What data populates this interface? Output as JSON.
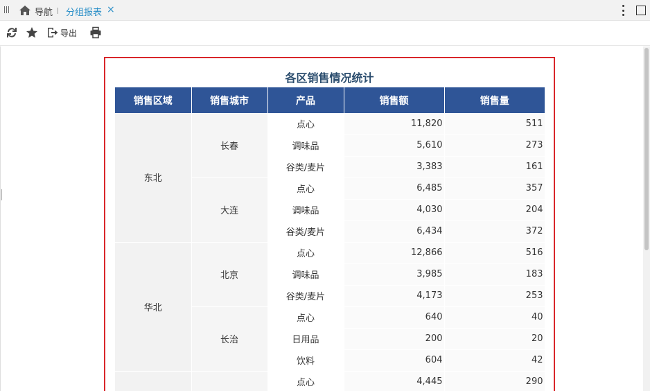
{
  "tabs": {
    "nav_label": "导航",
    "active_label": "分组报表",
    "close_glyph": "×"
  },
  "toolbar": {
    "export_label": "导出"
  },
  "report": {
    "title": "各区销售情况统计",
    "columns": [
      "销售区域",
      "销售城市",
      "产品",
      "销售额",
      "销售量"
    ],
    "groups": [
      {
        "region": "东北",
        "cities": [
          {
            "city": "长春",
            "rows": [
              {
                "product": "点心",
                "amount": "11,820",
                "qty": "511"
              },
              {
                "product": "调味品",
                "amount": "5,610",
                "qty": "273"
              },
              {
                "product": "谷类/麦片",
                "amount": "3,383",
                "qty": "161"
              }
            ]
          },
          {
            "city": "大连",
            "rows": [
              {
                "product": "点心",
                "amount": "6,485",
                "qty": "357"
              },
              {
                "product": "调味品",
                "amount": "4,030",
                "qty": "204"
              },
              {
                "product": "谷类/麦片",
                "amount": "6,434",
                "qty": "372"
              }
            ]
          }
        ]
      },
      {
        "region": "华北",
        "cities": [
          {
            "city": "北京",
            "rows": [
              {
                "product": "点心",
                "amount": "12,866",
                "qty": "516"
              },
              {
                "product": "调味品",
                "amount": "3,985",
                "qty": "183"
              },
              {
                "product": "谷类/麦片",
                "amount": "4,173",
                "qty": "253"
              }
            ]
          },
          {
            "city": "长治",
            "rows": [
              {
                "product": "点心",
                "amount": "640",
                "qty": "40"
              },
              {
                "product": "日用品",
                "amount": "200",
                "qty": "20"
              },
              {
                "product": "饮料",
                "amount": "604",
                "qty": "42"
              }
            ]
          }
        ]
      },
      {
        "region": "",
        "cities": [
          {
            "city": "",
            "rows": [
              {
                "product": "点心",
                "amount": "4,445",
                "qty": "290"
              }
            ]
          }
        ]
      }
    ]
  }
}
